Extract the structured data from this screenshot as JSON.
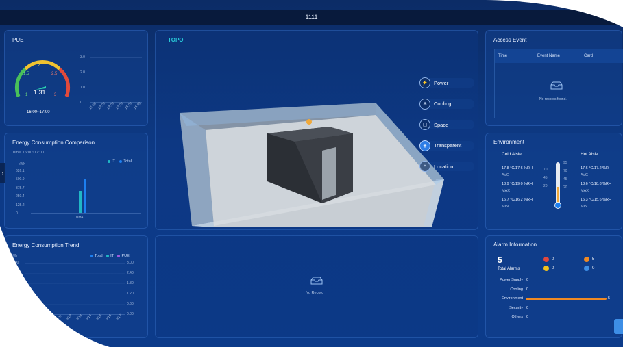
{
  "header": {
    "title": "1111"
  },
  "pue": {
    "title": "PUE",
    "value": "1.31",
    "time_range": "16:00~17:00",
    "gauge_labels": [
      "1",
      "1.5",
      "2",
      "2.5",
      "3"
    ],
    "chart_y_ticks": [
      "3.0",
      "2.0",
      "1.0",
      "0"
    ],
    "chart_x_ticks": [
      "11:00",
      "12:00",
      "13:00",
      "14:00",
      "15:00",
      "16:00"
    ]
  },
  "energy_comparison": {
    "title": "Energy Consumption Comparison",
    "time_label": "Time:  16:00~17:00",
    "unit": "kWh",
    "legend": [
      "IT",
      "Total"
    ],
    "y_ticks": [
      "626.1",
      "500.9",
      "375.7",
      "250.4",
      "125.2",
      "0"
    ],
    "x_label": "BM4"
  },
  "energy_trend": {
    "title": "Energy Consumption Trend",
    "unit": "kWh",
    "legend": [
      "Total",
      "IT",
      "PUE"
    ],
    "y_left_ticks": [
      "300",
      "200",
      "100"
    ],
    "y_right_ticks": [
      "3.00",
      "2.40",
      "1.80",
      "1.20",
      "0.60",
      "0.00"
    ],
    "x_ticks": [
      "3/8",
      "3/9",
      "3/10",
      "3/11",
      "3/12",
      "3/13",
      "3/14",
      "3/15",
      "3/16",
      "3/17"
    ]
  },
  "topo": {
    "tab": "TOPO",
    "menu": [
      {
        "label": "Power",
        "icon": "power-icon",
        "active": false
      },
      {
        "label": "Cooling",
        "icon": "cooling-icon",
        "active": false
      },
      {
        "label": "Space",
        "icon": "space-icon",
        "active": false
      },
      {
        "label": "Transparent",
        "icon": "transparent-icon",
        "active": true
      },
      {
        "label": "Location",
        "icon": "location-icon",
        "active": false
      }
    ],
    "bottom_empty": "No Record"
  },
  "access_event": {
    "title": "Access Event",
    "columns": [
      "Time",
      "Event Name",
      "Card"
    ],
    "empty": "No records found."
  },
  "environment": {
    "title": "Environment",
    "cold_title": "Cold Aisle",
    "hot_title": "Hot Aisle",
    "cold": [
      {
        "value": "17.8 °C/17.6 %RH",
        "label": "AVG"
      },
      {
        "value": "18.9 °C/19.0 %RH",
        "label": "MAX"
      },
      {
        "value": "16.7 °C/16.2 %RH",
        "label": "MIN"
      }
    ],
    "hot": [
      {
        "value": "17.6 °C/17.2 %RH",
        "label": "AVG"
      },
      {
        "value": "18.6 °C/18.8 %RH",
        "label": "MAX"
      },
      {
        "value": "16.3 °C/15.6 %RH",
        "label": "MIN"
      }
    ],
    "thermo_left": [
      "70",
      "45",
      "20"
    ],
    "thermo_right": [
      "95",
      "70",
      "45",
      "20"
    ]
  },
  "alarm": {
    "title": "Alarm Information",
    "total": "5",
    "total_label": "Total Alarms",
    "levels": [
      {
        "count": "0",
        "color": "#e0483e"
      },
      {
        "count": "5",
        "color": "#f08a24"
      },
      {
        "count": "0",
        "color": "#f2c21b"
      },
      {
        "count": "0",
        "color": "#3d8ee6"
      }
    ],
    "categories": [
      {
        "label": "Power Supply",
        "count": "0",
        "fraction": 0
      },
      {
        "label": "Cooling",
        "count": "0",
        "fraction": 0
      },
      {
        "label": "Environment",
        "count": "5",
        "fraction": 1
      },
      {
        "label": "Security",
        "count": "0",
        "fraction": 0
      },
      {
        "label": "Others",
        "count": "0",
        "fraction": 0
      }
    ]
  },
  "colors": {
    "accent": "#28c8d8",
    "bar_it": "#20b7c6",
    "bar_total": "#1d7ff0",
    "alarm_bar": "#f08a24"
  }
}
